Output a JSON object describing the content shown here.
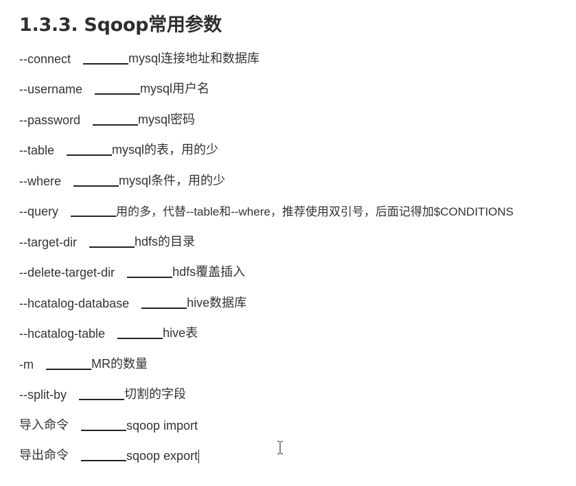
{
  "section": {
    "heading": "1.3.3. Sqoop常用参数"
  },
  "params": [
    {
      "name": "--connect",
      "desc": "mysql连接地址和数据库"
    },
    {
      "name": "--username",
      "desc": "mysql用户名"
    },
    {
      "name": "--password",
      "desc": "mysql密码"
    },
    {
      "name": "--table",
      "desc": "mysql的表，用的少"
    },
    {
      "name": "--where",
      "desc": "mysql条件，用的少"
    },
    {
      "name": "--query",
      "desc": "用的多，代替--table和--where，推荐使用双引号，后面记得加$CONDITIONS"
    },
    {
      "name": "--target-dir",
      "desc": "hdfs的目录"
    },
    {
      "name": "--delete-target-dir",
      "desc": "hdfs覆盖插入"
    },
    {
      "name": "--hcatalog-database",
      "desc": "hive数据库"
    },
    {
      "name": "--hcatalog-table",
      "desc": "hive表"
    },
    {
      "name": "-m",
      "desc": "MR的数量"
    },
    {
      "name": "--split-by",
      "desc": "切割的字段"
    },
    {
      "name": "导入命令",
      "desc": "sqoop import"
    },
    {
      "name": "导出命令",
      "desc": "sqoop export"
    }
  ],
  "icons": {
    "text_cursor": "i-beam-cursor-icon"
  }
}
